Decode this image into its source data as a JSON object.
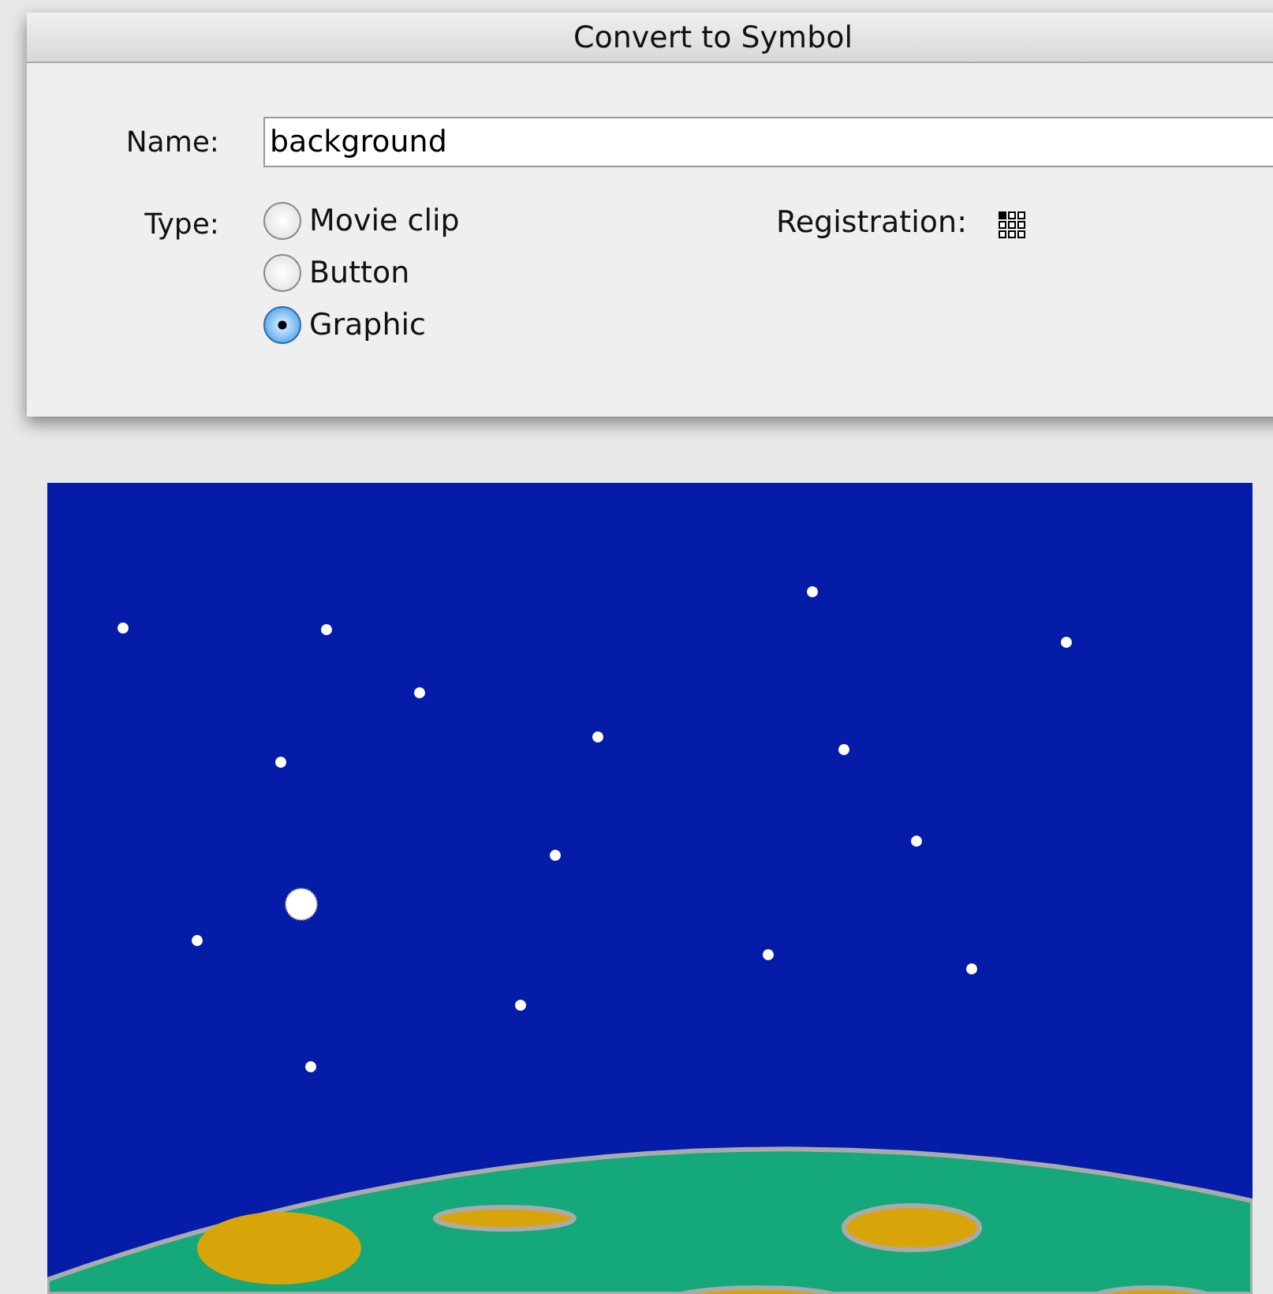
{
  "dialog": {
    "title": "Convert to Symbol",
    "name_label": "Name:",
    "name_value": "background",
    "type_label": "Type:",
    "registration_label": "Registration:",
    "types": [
      {
        "label": "Movie clip",
        "selected": false
      },
      {
        "label": "Button",
        "selected": false
      },
      {
        "label": "Graphic",
        "selected": true
      }
    ]
  }
}
